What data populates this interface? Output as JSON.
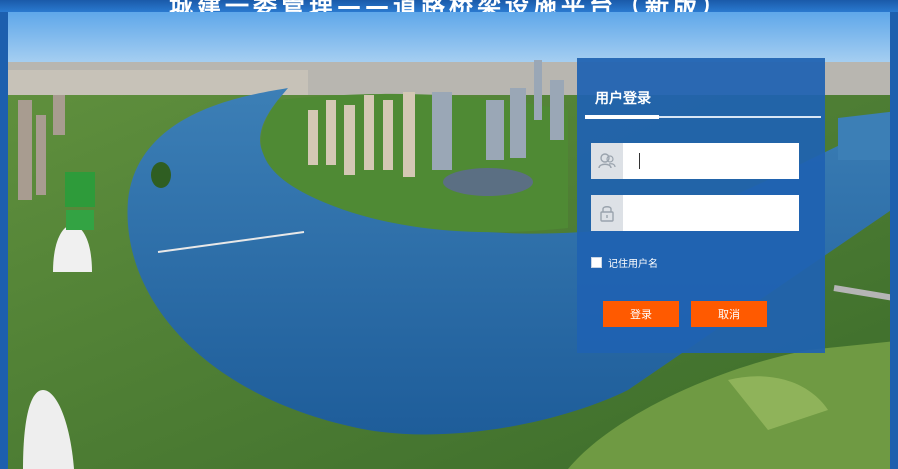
{
  "page": {
    "title": "城建一委管理——道路桥梁设施平台（新版）"
  },
  "login": {
    "title": "用户登录",
    "username_value": "",
    "password_value": "",
    "remember_label": "记住用户名",
    "login_button": "登录",
    "cancel_button": "取消"
  },
  "icons": {
    "username": "users-icon",
    "password": "lock-icon"
  },
  "colors": {
    "panel": "#1f62b2",
    "button": "#ff5a00",
    "frame": "#1d5fae"
  }
}
